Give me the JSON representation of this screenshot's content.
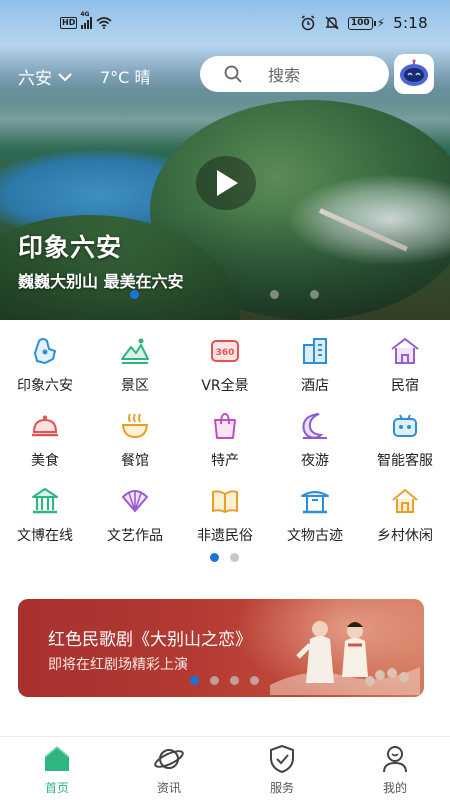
{
  "status_bar": {
    "hd": "HD",
    "network": "4G",
    "battery": "100",
    "time": "5:18"
  },
  "header": {
    "city": "六安",
    "weather": "7°C 晴",
    "search_placeholder": "搜索"
  },
  "hero": {
    "title": "印象六安",
    "subtitle": "巍巍大别山 最美在六安",
    "active_slide": 0,
    "slide_count": 3
  },
  "grid": {
    "items": [
      {
        "label": "印象六安",
        "icon": "map-icon"
      },
      {
        "label": "景区",
        "icon": "mountain-icon"
      },
      {
        "label": "VR全景",
        "icon": "vr-360-icon"
      },
      {
        "label": "酒店",
        "icon": "hotel-icon"
      },
      {
        "label": "民宿",
        "icon": "homestay-icon"
      },
      {
        "label": "美食",
        "icon": "cloche-icon"
      },
      {
        "label": "餐馆",
        "icon": "bowl-icon"
      },
      {
        "label": "特产",
        "icon": "gift-bag-icon"
      },
      {
        "label": "夜游",
        "icon": "moon-icon"
      },
      {
        "label": "智能客服",
        "icon": "robot-icon"
      },
      {
        "label": "文博在线",
        "icon": "museum-icon"
      },
      {
        "label": "文艺作品",
        "icon": "fan-icon"
      },
      {
        "label": "非遗民俗",
        "icon": "book-icon"
      },
      {
        "label": "文物古迹",
        "icon": "pavilion-icon"
      },
      {
        "label": "乡村休闲",
        "icon": "house-icon"
      }
    ],
    "active_page": 0,
    "page_count": 2
  },
  "banner": {
    "title": "红色民歌剧《大别山之恋》",
    "subtitle": "即将在红剧场精彩上演",
    "active_slide": 0,
    "slide_count": 4
  },
  "tabs": [
    {
      "label": "首页",
      "icon": "home-icon",
      "active": true
    },
    {
      "label": "资讯",
      "icon": "planet-icon",
      "active": false
    },
    {
      "label": "服务",
      "icon": "shield-check-icon",
      "active": false
    },
    {
      "label": "我的",
      "icon": "user-icon",
      "active": false
    }
  ],
  "colors": {
    "primary": "#2fb57f",
    "dot_active": "#1a73d9",
    "dot_inactive": "#c8c8c8",
    "banner": "#b33b33"
  }
}
